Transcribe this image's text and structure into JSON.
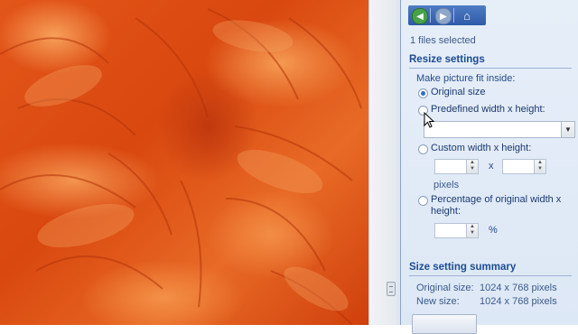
{
  "pane": {
    "files_selected": "1 files selected",
    "resize": {
      "heading": "Resize settings",
      "fit_label": "Make picture fit inside:",
      "original_size": "Original size",
      "predefined": "Predefined width x height:",
      "predefined_value": "",
      "custom": "Custom width x height:",
      "custom_width": "",
      "custom_height": "",
      "x_sep": "x",
      "pixels": "pixels",
      "percentage_line1": "Percentage of original width x",
      "percentage_line2": "height:",
      "percent_value": "",
      "percent_sign": "%",
      "selected_option": "original_size"
    },
    "summary": {
      "heading": "Size setting summary",
      "original_label": "Original size:",
      "original_value": "1024 x 768 pixels",
      "new_label": "New size:",
      "new_value": "1024 x 768 pixels"
    }
  },
  "icons": {
    "back": "back-arrow-icon",
    "forward": "forward-arrow-icon",
    "home": "home-icon"
  },
  "colors": {
    "pane_bg": "#dde8f6",
    "heading": "#1d4b92",
    "toolbar": "#2f5aa8"
  }
}
